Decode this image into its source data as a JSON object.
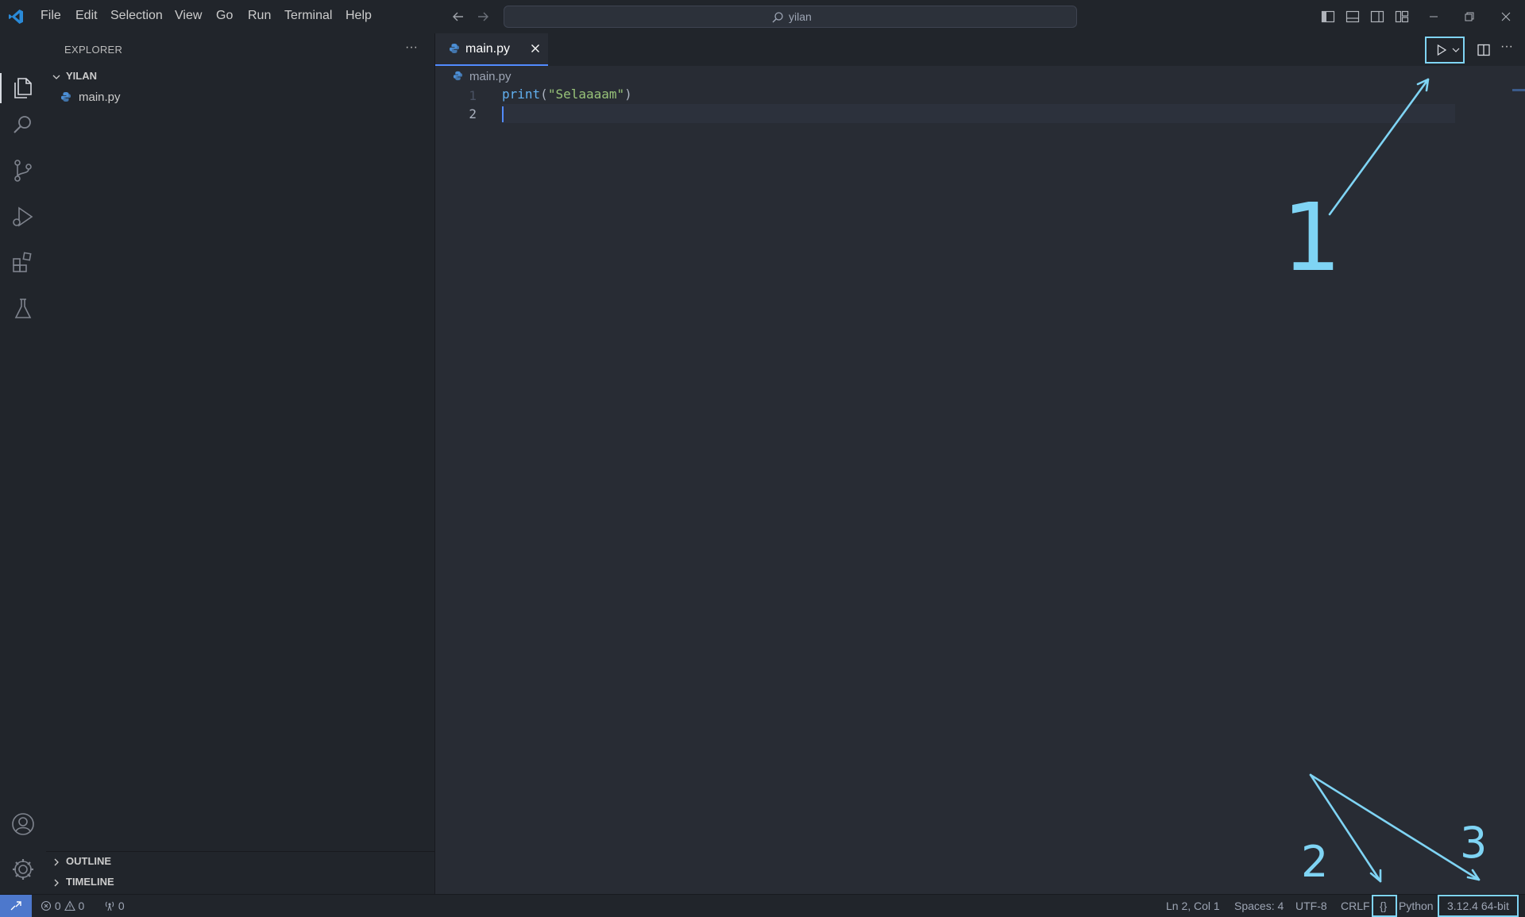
{
  "menu": [
    "File",
    "Edit",
    "Selection",
    "View",
    "Go",
    "Run",
    "Terminal",
    "Help"
  ],
  "search": {
    "text": "yilan"
  },
  "sidebar": {
    "title": "EXPLORER",
    "more": "···",
    "root_folder": "YILAN",
    "files": [
      "main.py"
    ],
    "sections": [
      "OUTLINE",
      "TIMELINE"
    ]
  },
  "editor": {
    "tab_label": "main.py",
    "breadcrumb": "main.py",
    "more": "···",
    "line_numbers": [
      "1",
      "2"
    ],
    "code": {
      "fn": "print",
      "open": "(",
      "str": "\"Selaaaam\"",
      "close": ")"
    }
  },
  "statusbar": {
    "errors": "0",
    "warnings": "0",
    "ports": "0",
    "cursor_pos": "Ln 2, Col 1",
    "spaces": "Spaces: 4",
    "encoding": "UTF-8",
    "eol": "CRLF",
    "braces": "{}",
    "language": "Python",
    "interpreter": "3.12.4 64-bit"
  },
  "annotations": {
    "n1": "1",
    "n2": "2",
    "n3": "3"
  },
  "colors": {
    "accent": "#528bff",
    "annotation": "#7fd4f4",
    "remote": "#4d78cc"
  }
}
